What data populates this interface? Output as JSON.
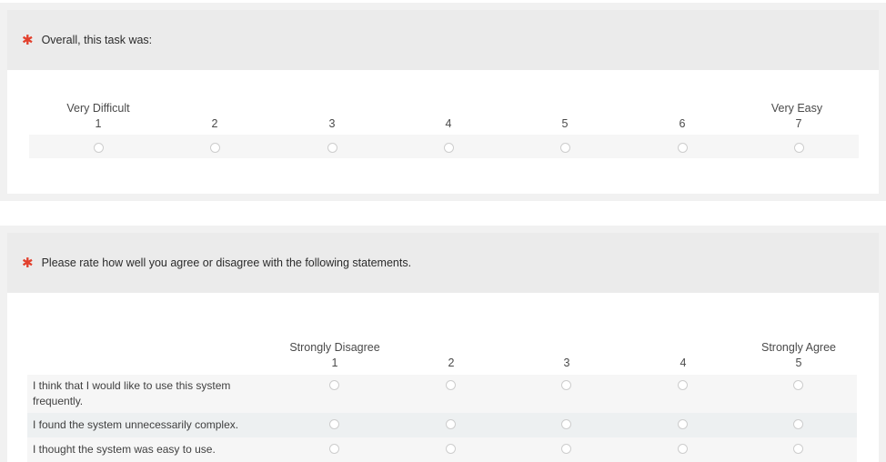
{
  "q1": {
    "question": "Overall, this task was:",
    "scale": [
      {
        "anchor": "Very Difficult",
        "num": "1"
      },
      {
        "anchor": "",
        "num": "2"
      },
      {
        "anchor": "",
        "num": "3"
      },
      {
        "anchor": "",
        "num": "4"
      },
      {
        "anchor": "",
        "num": "5"
      },
      {
        "anchor": "",
        "num": "6"
      },
      {
        "anchor": "Very Easy",
        "num": "7"
      }
    ]
  },
  "q2": {
    "question": "Please rate how well you agree or disagree with the following statements.",
    "scale": [
      {
        "anchor": "Strongly Disagree",
        "num": "1"
      },
      {
        "anchor": "",
        "num": "2"
      },
      {
        "anchor": "",
        "num": "3"
      },
      {
        "anchor": "",
        "num": "4"
      },
      {
        "anchor": "Strongly Agree",
        "num": "5"
      }
    ],
    "statements": [
      "I think that I would like to use this system frequently.",
      "I found the system unnecessarily complex.",
      "I thought the system was easy to use."
    ]
  },
  "colors": {
    "required_star": "#e2402d",
    "header_bg": "#ebebeb",
    "row_alt_bg": "#edf0f1"
  }
}
